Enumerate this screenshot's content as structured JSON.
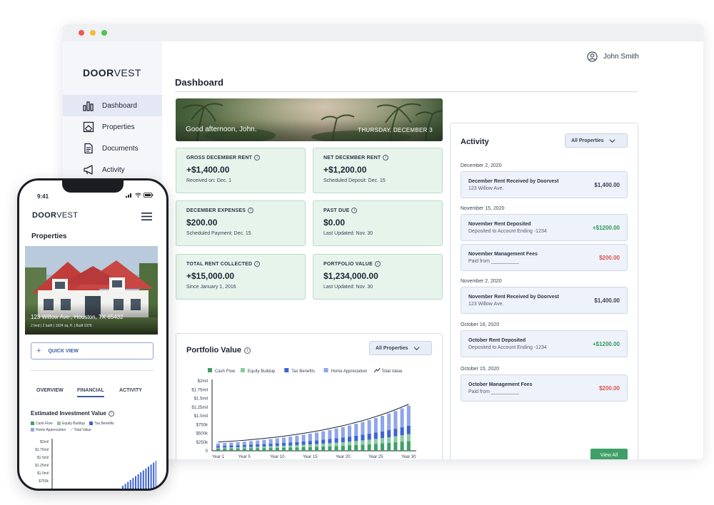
{
  "app": {
    "logo_bold": "DOOR",
    "logo_thin": "VEST",
    "user_name": "John Smith"
  },
  "sidebar": {
    "items": [
      {
        "label": "Dashboard",
        "icon": "bar-chart-icon",
        "active": true
      },
      {
        "label": "Properties",
        "icon": "house-image-icon",
        "active": false
      },
      {
        "label": "Documents",
        "icon": "document-icon",
        "active": false
      },
      {
        "label": "Activity",
        "icon": "megaphone-icon",
        "active": false
      }
    ]
  },
  "dashboard": {
    "title": "Dashboard",
    "greeting": "Good afternoon, John.",
    "date": "THURSDAY, DECEMBER 3",
    "cards": [
      {
        "label": "GROSS DECEMBER RENT",
        "value": "+$1,400.00",
        "sub": "Received on: Dec. 1"
      },
      {
        "label": "NET DECEMBER RENT",
        "value": "+$1,200.00",
        "sub": "Scheduled Deposit: Dec. 15"
      },
      {
        "label": "DECEMBER EXPENSES",
        "value": "$200.00",
        "sub": "Scheduled Payment: Dec. 15"
      },
      {
        "label": "PAST DUE",
        "value": "$0.00",
        "sub": "Last Updated: Nov. 30"
      },
      {
        "label": "TOTAL RENT COLLECTED",
        "value": "+$15,000.00",
        "sub": "Since January 1, 2016"
      },
      {
        "label": "PORTFOLIO VALUE",
        "value": "$1,234,000.00",
        "sub": "Last Updated: Nov. 30"
      }
    ]
  },
  "portfolio": {
    "title": "Portfolio Value",
    "filter": "All Properties"
  },
  "activity": {
    "title": "Activity",
    "filter": "All Properties",
    "groups": [
      {
        "date": "December 2, 2020",
        "items": [
          {
            "title": "December Rent Received by Doorvest",
            "desc": "123 Willow Ave.",
            "amount": "$1,400.00",
            "kind": "neutral"
          }
        ]
      },
      {
        "date": "November 15, 2020",
        "items": [
          {
            "title": "November Rent Deposited",
            "desc": "Deposited to Account Ending -1234",
            "amount": "+$1200.00",
            "kind": "pos"
          },
          {
            "title": "November Management Fees",
            "desc": "Paid from __________",
            "amount": "$200.00",
            "kind": "neg"
          }
        ]
      },
      {
        "date": "November 2, 2020",
        "items": [
          {
            "title": "November Rent Received by Doorvest",
            "desc": "123 Willow Ave.",
            "amount": "$1,400.00",
            "kind": "neutral"
          }
        ]
      },
      {
        "date": "October 16, 2020",
        "items": [
          {
            "title": "October Rent Deposited",
            "desc": "Deposited to Account Ending -1234",
            "amount": "+$1200.00",
            "kind": "pos"
          }
        ]
      },
      {
        "date": "October 15, 2020",
        "items": [
          {
            "title": "October Management Fees",
            "desc": "Paid from __________",
            "amount": "$200.00",
            "kind": "neg"
          }
        ]
      }
    ],
    "view_all": "View All"
  },
  "colors": {
    "cash_flow": "#3f9f68",
    "equity_buildup": "#8ccaa1",
    "tax_benefits": "#3e63d6",
    "home_appreciation": "#8fa6e8",
    "total_value": "#1d2433",
    "card_bg": "#e7f4ec"
  },
  "chart_data": [
    {
      "type": "bar",
      "stacked": true,
      "legend": [
        "Cash Flow",
        "Equity Buildup",
        "Tax Benefits",
        "Home Appreciation",
        "Total Value"
      ],
      "legend_position": "top",
      "y_ticks": [
        "$2mil",
        "$1.75mil",
        "$1.5mil",
        "$1.25mil",
        "$1.0mil",
        "$750k",
        "$500k",
        "$250k",
        "0"
      ],
      "x_ticks": [
        "Year 1",
        "Year 5",
        "Year 10",
        "Year 15",
        "Year 20",
        "Year 25",
        "Year 30"
      ],
      "ylim": [
        0,
        2000000
      ],
      "years": 30,
      "series": [
        {
          "name": "Cash Flow",
          "values": [
            60000,
            62000,
            64000,
            66000,
            68000,
            71000,
            74000,
            77000,
            80000,
            84000,
            88000,
            92000,
            97000,
            102000,
            108000,
            114000,
            121000,
            128000,
            136000,
            144000,
            153000,
            163000,
            174000,
            186000,
            199000,
            213000,
            228000,
            244000,
            262000,
            281000
          ]
        },
        {
          "name": "Equity Buildup",
          "values": [
            30000,
            32000,
            34000,
            36000,
            38000,
            41000,
            44000,
            47000,
            50000,
            53000,
            57000,
            61000,
            65000,
            69000,
            74000,
            79000,
            84000,
            90000,
            96000,
            102000,
            109000,
            116000,
            124000,
            132000,
            141000,
            150000,
            160000,
            171000,
            182000,
            194000
          ]
        },
        {
          "name": "Tax Benefits",
          "values": [
            50000,
            52000,
            54000,
            56000,
            59000,
            62000,
            65000,
            68000,
            72000,
            76000,
            80000,
            85000,
            90000,
            95000,
            101000,
            107000,
            113000,
            120000,
            127000,
            135000,
            143000,
            152000,
            161000,
            171000,
            181000,
            192000,
            203000,
            215000,
            228000,
            241000
          ]
        },
        {
          "name": "Home Appreciation",
          "values": [
            70000,
            76000,
            82000,
            89000,
            96000,
            104000,
            113000,
            122000,
            132000,
            143000,
            154000,
            166000,
            179000,
            193000,
            208000,
            224000,
            241000,
            259000,
            278000,
            298000,
            319000,
            342000,
            366000,
            391000,
            418000,
            446000,
            476000,
            508000,
            541000,
            576000
          ]
        }
      ],
      "total_line": [
        210000,
        222000,
        234000,
        247000,
        261000,
        278000,
        296000,
        314000,
        334000,
        356000,
        379000,
        404000,
        431000,
        459000,
        491000,
        524000,
        559000,
        597000,
        637000,
        679000,
        724000,
        773000,
        825000,
        880000,
        939000,
        1001000,
        1067000,
        1138000,
        1213000,
        1292000
      ]
    },
    {
      "type": "bar",
      "title": "Estimated Investment Value",
      "legend": [
        "Cash Flow",
        "Equity Buildup",
        "Tax Benefits",
        "Home Appreciation",
        "Total Value"
      ],
      "y_ticks": [
        "$2mil",
        "$1.75mil",
        "$1.5mil",
        "$1.25mil",
        "$1.0mil",
        "$750k"
      ],
      "visible_bars": 14
    }
  ],
  "phone": {
    "time": "9:41",
    "heading": "Properties",
    "address": "123 Willow Ave., Houston, TX 65432",
    "address_sub": "2 bed | 2 bath | 1624 sq. ft. | Built 1976",
    "quick_view": "QUICK VIEW",
    "tabs": [
      "OVERVIEW",
      "FINANCIAL",
      "ACTIVITY"
    ],
    "active_tab": "FINANCIAL",
    "chart_title": "Estimated Investment Value"
  }
}
